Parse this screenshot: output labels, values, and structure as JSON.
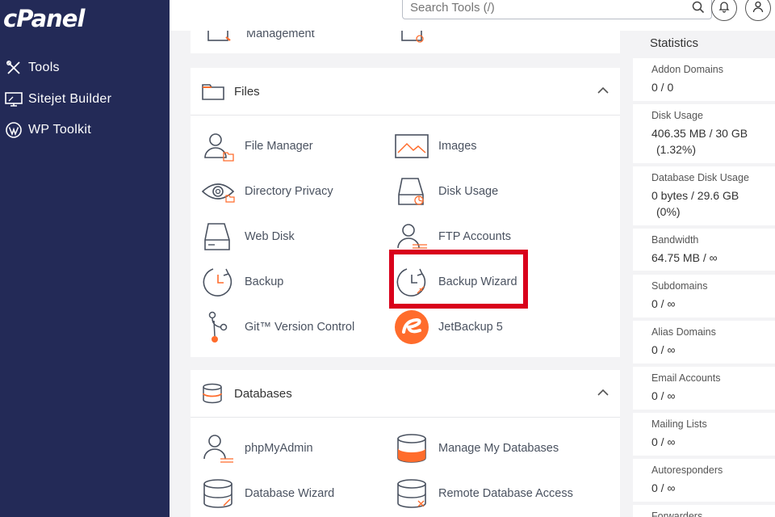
{
  "brand": {
    "logo": "cPanel"
  },
  "sidebar": {
    "items": [
      {
        "label": "Tools",
        "icon": "tools-icon"
      },
      {
        "label": "Sitejet Builder",
        "icon": "monitor-icon"
      },
      {
        "label": "WP Toolkit",
        "icon": "wordpress-icon"
      }
    ]
  },
  "topbar": {
    "search_placeholder": "Search Tools (/)"
  },
  "top_partial": {
    "left_label": "Management"
  },
  "files": {
    "title": "Files",
    "tools": [
      {
        "label": "File Manager",
        "icon": "file-manager-icon"
      },
      {
        "label": "Images",
        "icon": "images-icon"
      },
      {
        "label": "Directory Privacy",
        "icon": "eye-icon"
      },
      {
        "label": "Disk Usage",
        "icon": "disk-usage-icon"
      },
      {
        "label": "Web Disk",
        "icon": "web-disk-icon"
      },
      {
        "label": "FTP Accounts",
        "icon": "ftp-accounts-icon"
      },
      {
        "label": "Backup",
        "icon": "backup-icon"
      },
      {
        "label": "Backup Wizard",
        "icon": "backup-wizard-icon"
      },
      {
        "label": "Git™ Version Control",
        "icon": "git-icon"
      },
      {
        "label": "JetBackup 5",
        "icon": "jetbackup-icon"
      }
    ]
  },
  "databases": {
    "title": "Databases",
    "tools": [
      {
        "label": "phpMyAdmin",
        "icon": "phpmyadmin-icon"
      },
      {
        "label": "Manage My Databases",
        "icon": "database-icon"
      },
      {
        "label": "Database Wizard",
        "icon": "database-wizard-icon"
      },
      {
        "label": "Remote Database Access",
        "icon": "remote-database-icon"
      }
    ]
  },
  "statistics": {
    "title": "Statistics",
    "items": [
      {
        "label": "Addon Domains",
        "value": "0 / 0"
      },
      {
        "label": "Disk Usage",
        "value": "406.35 MB / 30 GB",
        "extra": "(1.32%)"
      },
      {
        "label": "Database Disk Usage",
        "value": "0 bytes / 29.6 GB",
        "extra": "(0%)"
      },
      {
        "label": "Bandwidth",
        "value": "64.75 MB / ∞"
      },
      {
        "label": "Subdomains",
        "value": "0 / ∞"
      },
      {
        "label": "Alias Domains",
        "value": "0 / ∞"
      },
      {
        "label": "Email Accounts",
        "value": "0 / ∞"
      },
      {
        "label": "Mailing Lists",
        "value": "0 / ∞"
      },
      {
        "label": "Autoresponders",
        "value": "0 / ∞"
      },
      {
        "label": "Forwarders",
        "value": ""
      }
    ]
  },
  "colors": {
    "sidebar": "#232a57",
    "accent": "#ff6c2c",
    "highlight": "#d9001b"
  }
}
